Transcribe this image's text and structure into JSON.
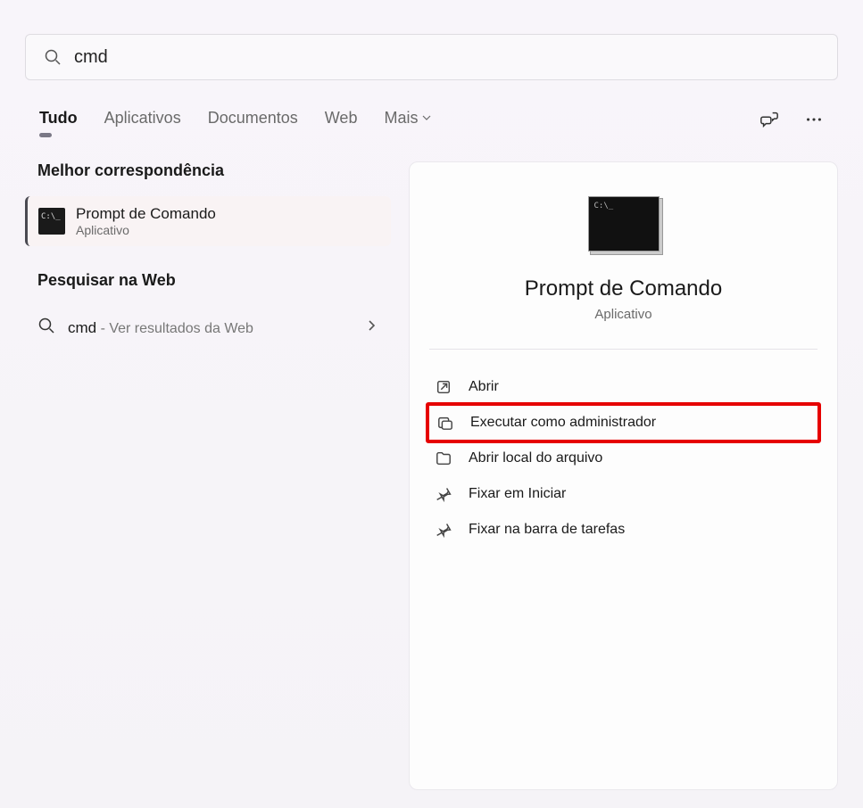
{
  "search": {
    "query": "cmd"
  },
  "tabs": {
    "all": "Tudo",
    "apps": "Aplicativos",
    "documents": "Documentos",
    "web": "Web",
    "more": "Mais"
  },
  "left": {
    "best_match_heading": "Melhor correspondência",
    "best_match": {
      "title": "Prompt de Comando",
      "subtitle": "Aplicativo"
    },
    "web_heading": "Pesquisar na Web",
    "web_result": {
      "query": "cmd",
      "suffix": " - Ver resultados da Web"
    }
  },
  "preview": {
    "title": "Prompt de Comando",
    "subtitle": "Aplicativo",
    "actions": {
      "open": "Abrir",
      "run_admin": "Executar como administrador",
      "open_location": "Abrir local do arquivo",
      "pin_start": "Fixar em Iniciar",
      "pin_taskbar": "Fixar na barra de tarefas"
    }
  }
}
